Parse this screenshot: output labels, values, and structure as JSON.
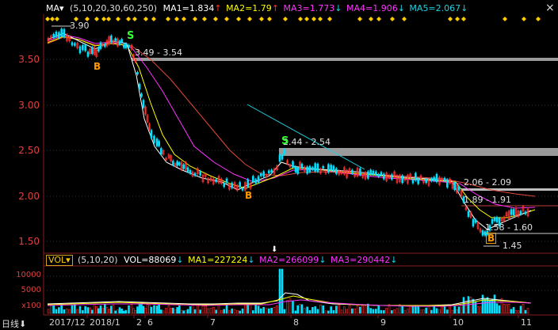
{
  "toolbar": {
    "ma_selector": "MA▾",
    "ma_params": "(5,10,20,30,60,250)",
    "ma1": "MA1=1.834",
    "ma2": "MA2=1.79",
    "ma3": "MA3=1.773",
    "ma4": "MA4=1.906",
    "ma5": "MA5=2.067",
    "close_glyph": "×",
    "arrow_up": "↑",
    "arrow_down": "↓"
  },
  "price_axis": {
    "ticks": [
      "3.50",
      "3.00",
      "2.50",
      "2.00",
      "1.50"
    ]
  },
  "annotations": {
    "high": "3.90",
    "range1": "3.49 - 3.54",
    "range2": "2.44 - 2.54",
    "range3": "2.06 - 2.09",
    "range4": "1.89 - 1.91",
    "range5": "1.58 - 1.60",
    "low": "1.45",
    "sig_b": "B",
    "sig_s": "S"
  },
  "volume_panel": {
    "selector": "VOL▾",
    "params": "(5,10,20)",
    "vol": "VOL=88069",
    "ma1": "MA1=227224",
    "ma2": "MA2=266099",
    "ma3": "MA3=290442",
    "ticks": [
      "10000",
      "5000",
      "x100"
    ]
  },
  "period": {
    "label": "日线",
    "arrow": "⬇"
  },
  "time_axis": {
    "labels": [
      "2017/12",
      "2018/1",
      "2",
      "6",
      "7",
      "8",
      "9",
      "10",
      "11"
    ]
  },
  "colors": {
    "up": "#ff3232",
    "down": "#00e0ff",
    "ma_white": "#ffffff",
    "ma_yellow": "#ffff00",
    "ma_magenta": "#ff33ff",
    "ma_red": "#e04a3a",
    "ma_cyan": "#20d0e0",
    "grid": "#8a1a1a"
  }
}
